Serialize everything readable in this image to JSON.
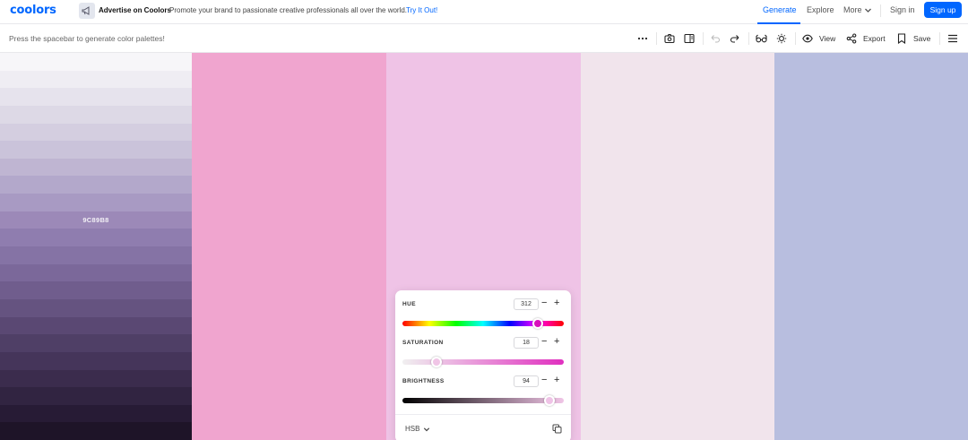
{
  "nav": {
    "logo": "coolors",
    "ad_title": "Advertise on Coolors",
    "ad_text": "Promote your brand to passionate creative professionals all over the world.",
    "ad_link": "Try It Out!",
    "generate": "Generate",
    "explore": "Explore",
    "more": "More",
    "sign_in": "Sign in",
    "sign_up": "Sign up"
  },
  "toolbar": {
    "hint": "Press the spacebar to generate color palettes!",
    "view": "View",
    "export": "Export",
    "save": "Save"
  },
  "shades": {
    "selected_hex": "9C89B8",
    "colors": [
      "#f7f6f9",
      "#efedf3",
      "#e6e3ed",
      "#ddd9e6",
      "#d4cee0",
      "#cac3da",
      "#bfb5d2",
      "#b3a8cb",
      "#a89ac3",
      "#9c89b8",
      "#8f7daf",
      "#8573a5",
      "#7b689a",
      "#705d8d",
      "#655380",
      "#5a4873",
      "#4f3f66",
      "#45355a",
      "#3b2c4d",
      "#312441",
      "#271b35",
      "#1e1428"
    ]
  },
  "palette": {
    "columns": [
      "#f0a5cf",
      "#efc3e6",
      "#f1e4ec",
      "#b8bedf"
    ]
  },
  "hsb": {
    "hue_label": "HUE",
    "hue": "312",
    "saturation_label": "SATURATION",
    "saturation": "18",
    "brightness_label": "BRIGHTNESS",
    "brightness": "94",
    "mode": "HSB",
    "hue_fraction": 0.84,
    "saturation_fraction": 0.21,
    "brightness_fraction": 0.91
  },
  "colors": {
    "accent": "#0066ff"
  }
}
